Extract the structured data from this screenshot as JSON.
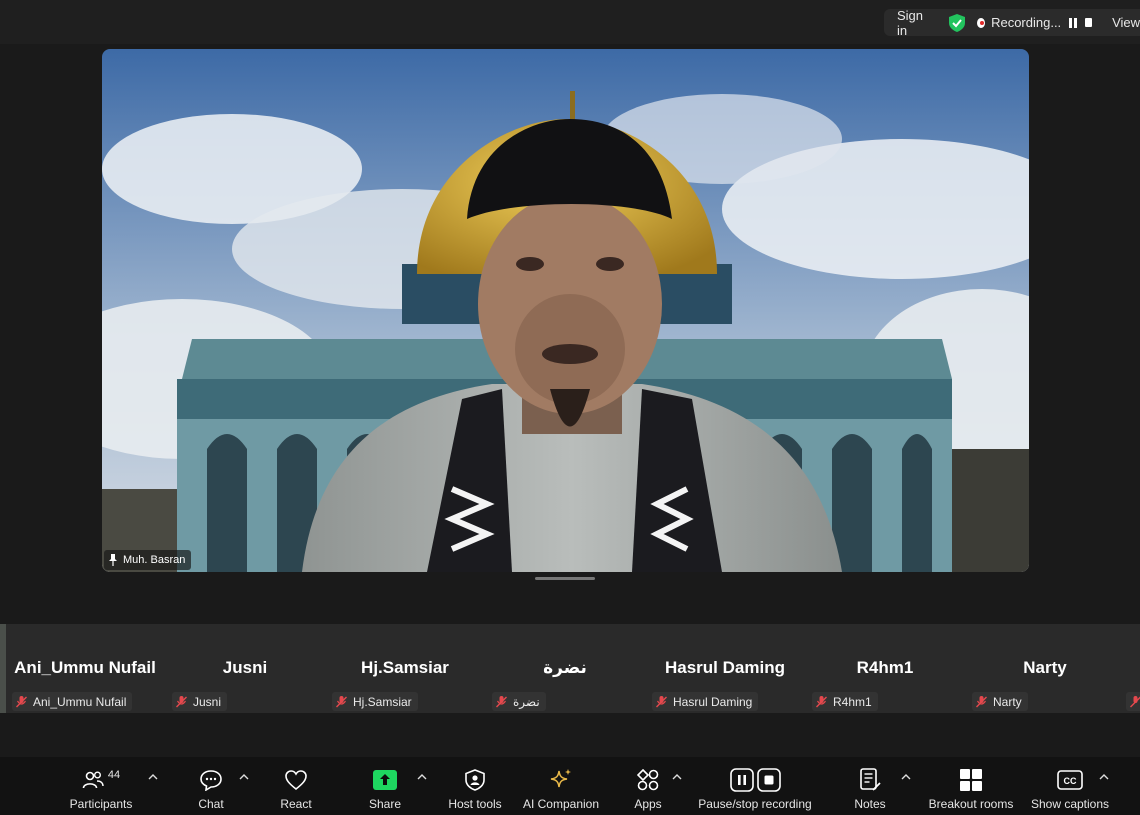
{
  "topbar": {
    "sign_in": "Sign in",
    "recording": "Recording...",
    "view": "View"
  },
  "main_video": {
    "speaker_name": "Muh. Basran"
  },
  "gallery": [
    {
      "display_name": "Ani_Ummu Nufail",
      "tag": "Ani_Ummu Nufail"
    },
    {
      "display_name": "Jusni",
      "tag": "Jusni"
    },
    {
      "display_name": "Hj.Samsiar",
      "tag": "Hj.Samsiar"
    },
    {
      "display_name": "نضرة",
      "tag": "نضرة"
    },
    {
      "display_name": "Hasrul Daming",
      "tag": "Hasrul Daming"
    },
    {
      "display_name": "R4hm1",
      "tag": "R4hm1"
    },
    {
      "display_name": "Narty",
      "tag": "Narty"
    }
  ],
  "toolbar": {
    "participants_label": "Participants",
    "participants_count": "44",
    "chat_label": "Chat",
    "react_label": "React",
    "share_label": "Share",
    "host_tools_label": "Host tools",
    "ai_companion_label": "AI Companion",
    "apps_label": "Apps",
    "pause_stop_label": "Pause/stop recording",
    "notes_label": "Notes",
    "breakout_label": "Breakout rooms",
    "captions_label": "Show captions"
  },
  "colors": {
    "share_green": "#1ed760",
    "shield_green": "#22c35e",
    "ai_gold": "#e9b949",
    "recording_red": "#e02828"
  }
}
